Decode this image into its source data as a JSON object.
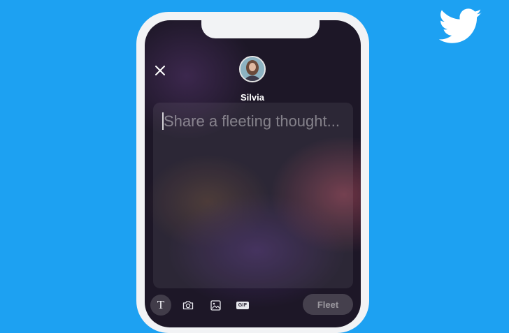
{
  "app": {
    "brand_icon": "twitter-bird-icon",
    "brand_color": "#1da1f2"
  },
  "header": {
    "close_icon": "close-icon",
    "avatar_icon": "avatar",
    "username": "Silvia"
  },
  "compose": {
    "placeholder": "Share a fleeting thought...",
    "value": ""
  },
  "toolbar": {
    "tools": [
      {
        "name": "text",
        "icon": "text-format-icon",
        "glyph": "T",
        "active": true
      },
      {
        "name": "camera",
        "icon": "camera-icon",
        "active": false
      },
      {
        "name": "image",
        "icon": "image-icon",
        "active": false
      },
      {
        "name": "gif",
        "icon": "gif-icon",
        "glyph": "GIF",
        "active": false
      }
    ],
    "submit_label": "Fleet"
  }
}
